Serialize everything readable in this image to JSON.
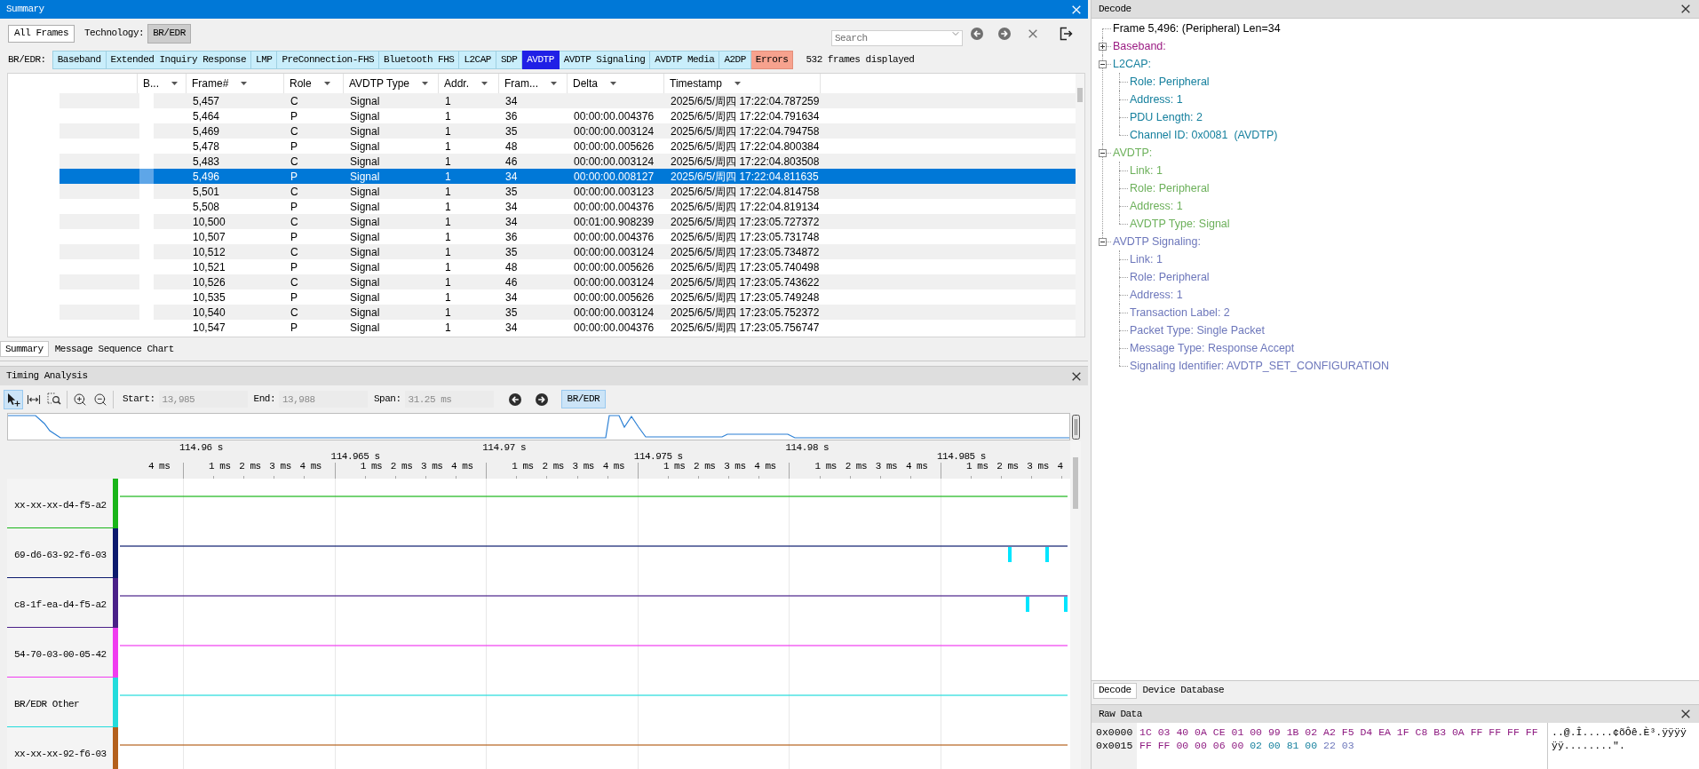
{
  "summary": {
    "title": "Summary",
    "toolbar": {
      "view_button": "All Frames",
      "technology_label": "Technology:",
      "technology_button": "BR/EDR",
      "search": {
        "placeholder": "Search"
      }
    },
    "filter": {
      "label": "BR/EDR:",
      "tabs": [
        {
          "label": "Baseband",
          "kind": "protocol",
          "selected": false
        },
        {
          "label": "Extended Inquiry Response",
          "kind": "protocol",
          "selected": false
        },
        {
          "label": "LMP",
          "kind": "protocol",
          "selected": false
        },
        {
          "label": "PreConnection-FHS",
          "kind": "protocol",
          "selected": false
        },
        {
          "label": "Bluetooth FHS",
          "kind": "protocol",
          "selected": false
        },
        {
          "label": "L2CAP",
          "kind": "protocol",
          "selected": false
        },
        {
          "label": "SDP",
          "kind": "protocol",
          "selected": false
        },
        {
          "label": "AVDTP",
          "kind": "protocol",
          "selected": true
        },
        {
          "label": "AVDTP Signaling",
          "kind": "protocol",
          "selected": false
        },
        {
          "label": "AVDTP Media",
          "kind": "protocol",
          "selected": false
        },
        {
          "label": "A2DP",
          "kind": "protocol",
          "selected": false
        },
        {
          "label": "Errors",
          "kind": "error",
          "selected": false
        }
      ],
      "status": "532 frames displayed"
    },
    "table": {
      "columns": [
        "B...",
        "Frame#",
        "Role",
        "AVDTP Type",
        "Addr.",
        "Fram...",
        "Delta",
        "Timestamp"
      ],
      "rows": [
        {
          "frame_no": "5,457",
          "role": "C",
          "avdtp_type": "Signal",
          "addr": "1",
          "column_6": "34",
          "timestamp": "2025/6/5/周四 17:22:04.787259",
          "selected": false
        },
        {
          "frame_no": "5,464",
          "role": "P",
          "avdtp_type": "Signal",
          "addr": "1",
          "column_6": "36",
          "delta": "00:00:00.004376",
          "timestamp": "2025/6/5/周四 17:22:04.791634",
          "selected": false
        },
        {
          "frame_no": "5,469",
          "role": "C",
          "avdtp_type": "Signal",
          "addr": "1",
          "column_6": "35",
          "delta": "00:00:00.003124",
          "timestamp": "2025/6/5/周四 17:22:04.794758",
          "selected": false
        },
        {
          "frame_no": "5,478",
          "role": "P",
          "avdtp_type": "Signal",
          "addr": "1",
          "column_6": "48",
          "delta": "00:00:00.005626",
          "timestamp": "2025/6/5/周四 17:22:04.800384",
          "selected": false
        },
        {
          "frame_no": "5,483",
          "role": "C",
          "avdtp_type": "Signal",
          "addr": "1",
          "column_6": "46",
          "delta": "00:00:00.003124",
          "timestamp": "2025/6/5/周四 17:22:04.803508",
          "selected": false
        },
        {
          "frame_no": "5,496",
          "role": "P",
          "avdtp_type": "Signal",
          "addr": "1",
          "column_6": "34",
          "delta": "00:00:00.008127",
          "timestamp": "2025/6/5/周四 17:22:04.811635",
          "selected": true
        },
        {
          "frame_no": "5,501",
          "role": "C",
          "avdtp_type": "Signal",
          "addr": "1",
          "column_6": "35",
          "delta": "00:00:00.003123",
          "timestamp": "2025/6/5/周四 17:22:04.814758",
          "selected": false
        },
        {
          "frame_no": "5,508",
          "role": "P",
          "avdtp_type": "Signal",
          "addr": "1",
          "column_6": "34",
          "delta": "00:00:00.004376",
          "timestamp": "2025/6/5/周四 17:22:04.819134",
          "selected": false
        },
        {
          "frame_no": "10,500",
          "role": "C",
          "avdtp_type": "Signal",
          "addr": "1",
          "column_6": "34",
          "delta": "00:01:00.908239",
          "timestamp": "2025/6/5/周四 17:23:05.727372",
          "selected": false
        },
        {
          "frame_no": "10,507",
          "role": "P",
          "avdtp_type": "Signal",
          "addr": "1",
          "column_6": "36",
          "delta": "00:00:00.004376",
          "timestamp": "2025/6/5/周四 17:23:05.731748",
          "selected": false
        },
        {
          "frame_no": "10,512",
          "role": "C",
          "avdtp_type": "Signal",
          "addr": "1",
          "column_6": "35",
          "delta": "00:00:00.003124",
          "timestamp": "2025/6/5/周四 17:23:05.734872",
          "selected": false
        },
        {
          "frame_no": "10,521",
          "role": "P",
          "avdtp_type": "Signal",
          "addr": "1",
          "column_6": "48",
          "delta": "00:00:00.005626",
          "timestamp": "2025/6/5/周四 17:23:05.740498",
          "selected": false
        },
        {
          "frame_no": "10,526",
          "role": "C",
          "avdtp_type": "Signal",
          "addr": "1",
          "column_6": "46",
          "delta": "00:00:00.003124",
          "timestamp": "2025/6/5/周四 17:23:05.743622",
          "selected": false
        },
        {
          "frame_no": "10,535",
          "role": "P",
          "avdtp_type": "Signal",
          "addr": "1",
          "column_6": "34",
          "delta": "00:00:00.005626",
          "timestamp": "2025/6/5/周四 17:23:05.749248",
          "selected": false
        },
        {
          "frame_no": "10,540",
          "role": "C",
          "avdtp_type": "Signal",
          "addr": "1",
          "column_6": "35",
          "delta": "00:00:00.003124",
          "timestamp": "2025/6/5/周四 17:23:05.752372",
          "selected": false
        },
        {
          "frame_no": "10,547",
          "role": "P",
          "avdtp_type": "Signal",
          "addr": "1",
          "column_6": "34",
          "delta": "00:00:00.004376",
          "timestamp": "2025/6/5/周四 17:23:05.756747",
          "selected": false
        }
      ]
    },
    "tabs": [
      {
        "label": "Summary",
        "selected": true
      },
      {
        "label": "Message Sequence Chart",
        "selected": false
      }
    ]
  },
  "timing": {
    "title": "Timing Analysis",
    "tools": [
      {
        "kind": "pointer",
        "selected": true
      },
      {
        "kind": "range",
        "selected": false
      },
      {
        "kind": "zoom-area",
        "selected": false
      },
      {
        "kind": "zoom-in",
        "selected": false
      },
      {
        "kind": "zoom-out",
        "selected": false
      }
    ],
    "fields": [
      {
        "label": "Start:",
        "value": "13,985"
      },
      {
        "label": "End:",
        "value": "13,988"
      },
      {
        "label": "Span:",
        "value": "31.25 ms"
      }
    ],
    "mode": {
      "label": "BR/EDR",
      "selected": true
    },
    "ruler": {
      "leading_label": "4 ms",
      "major": [
        {
          "label": "114.96 s",
          "minor": [
            "1 ms",
            "2 ms",
            "3 ms",
            "4 ms"
          ]
        },
        {
          "label": "114.965 s",
          "minor": [
            "1 ms",
            "2 ms",
            "3 ms",
            "4 ms"
          ]
        },
        {
          "label": "114.97 s",
          "minor": [
            "1 ms",
            "2 ms",
            "3 ms",
            "4 ms"
          ]
        },
        {
          "label": "114.975 s",
          "minor": [
            "1 ms",
            "2 ms",
            "3 ms",
            "4 ms"
          ]
        },
        {
          "label": "114.98 s",
          "minor": [
            "1 ms",
            "2 ms",
            "3 ms",
            "4 ms"
          ]
        },
        {
          "label": "114.985 s",
          "minor": [
            "1 ms",
            "2 ms",
            "3 ms",
            "4"
          ]
        }
      ]
    },
    "lanes": [
      {
        "label": "xx-xx-xx-d4-f5-a2",
        "color": "#19b519"
      },
      {
        "label": "69-d6-63-92-f6-03",
        "color": "#0c1a6e"
      },
      {
        "label": "c8-1f-ea-d4-f5-a2",
        "color": "#4a2088"
      },
      {
        "label": "54-70-03-00-05-42",
        "color": "#f03cf0"
      },
      {
        "label": "BR/EDR Other",
        "color": "#22dcdc"
      },
      {
        "label": "xx-xx-xx-92-f6-03",
        "color": "#b4601c"
      }
    ]
  },
  "decode": {
    "title": "Decode",
    "tree": [
      {
        "label": "Frame 5,496: (Peripheral) Len=34",
        "color": "#000000"
      },
      {
        "label": "Baseband:",
        "color": "#9a1a82",
        "expanded": false
      },
      {
        "label": "L2CAP:",
        "color": "#16809e",
        "expanded": true,
        "children": [
          {
            "label": "Role: Peripheral"
          },
          {
            "label": "Address: 1"
          },
          {
            "label": "PDU Length: 2"
          },
          {
            "label": "Channel ID: 0x0081  (AVDTP)"
          }
        ]
      },
      {
        "label": "AVDTP:",
        "color": "#6cb05a",
        "expanded": true,
        "children": [
          {
            "label": "Link: 1"
          },
          {
            "label": "Role: Peripheral"
          },
          {
            "label": "Address: 1"
          },
          {
            "label": "AVDTP Type: Signal"
          }
        ]
      },
      {
        "label": "AVDTP Signaling:",
        "color": "#6d77bb",
        "expanded": true,
        "children": [
          {
            "label": "Link: 1"
          },
          {
            "label": "Role: Peripheral"
          },
          {
            "label": "Address: 1"
          },
          {
            "label": "Transaction Label: 2"
          },
          {
            "label": "Packet Type: Single Packet"
          },
          {
            "label": "Message Type: Response Accept"
          },
          {
            "label": "Signaling Identifier: AVDTP_SET_CONFIGURATION"
          }
        ]
      }
    ],
    "tabs": [
      {
        "label": "Decode",
        "selected": true
      },
      {
        "label": "Device Database",
        "selected": false
      }
    ]
  },
  "raw_data": {
    "title": "Raw Data",
    "rows": [
      {
        "offset": "0x0000",
        "segments": [
          {
            "text": "1C 03 40 0A CE 01 00 99 1B 02 A2 F5 D4 EA 1F C8 B3 0A FF FF FF FF",
            "color": "#8e1a80"
          }
        ],
        "ascii": "..@.Î.....¢õÔê.È³.ÿÿÿÿ"
      },
      {
        "offset": "0x0015",
        "segments": [
          {
            "text": "FF FF 00 00 06 00",
            "color": "#8e1a80"
          },
          {
            "text": "02 00 81 00",
            "color": "#16809e"
          },
          {
            "text": "22 03",
            "color": "#6d77bb"
          }
        ],
        "ascii": "ÿÿ........\"."
      }
    ]
  }
}
